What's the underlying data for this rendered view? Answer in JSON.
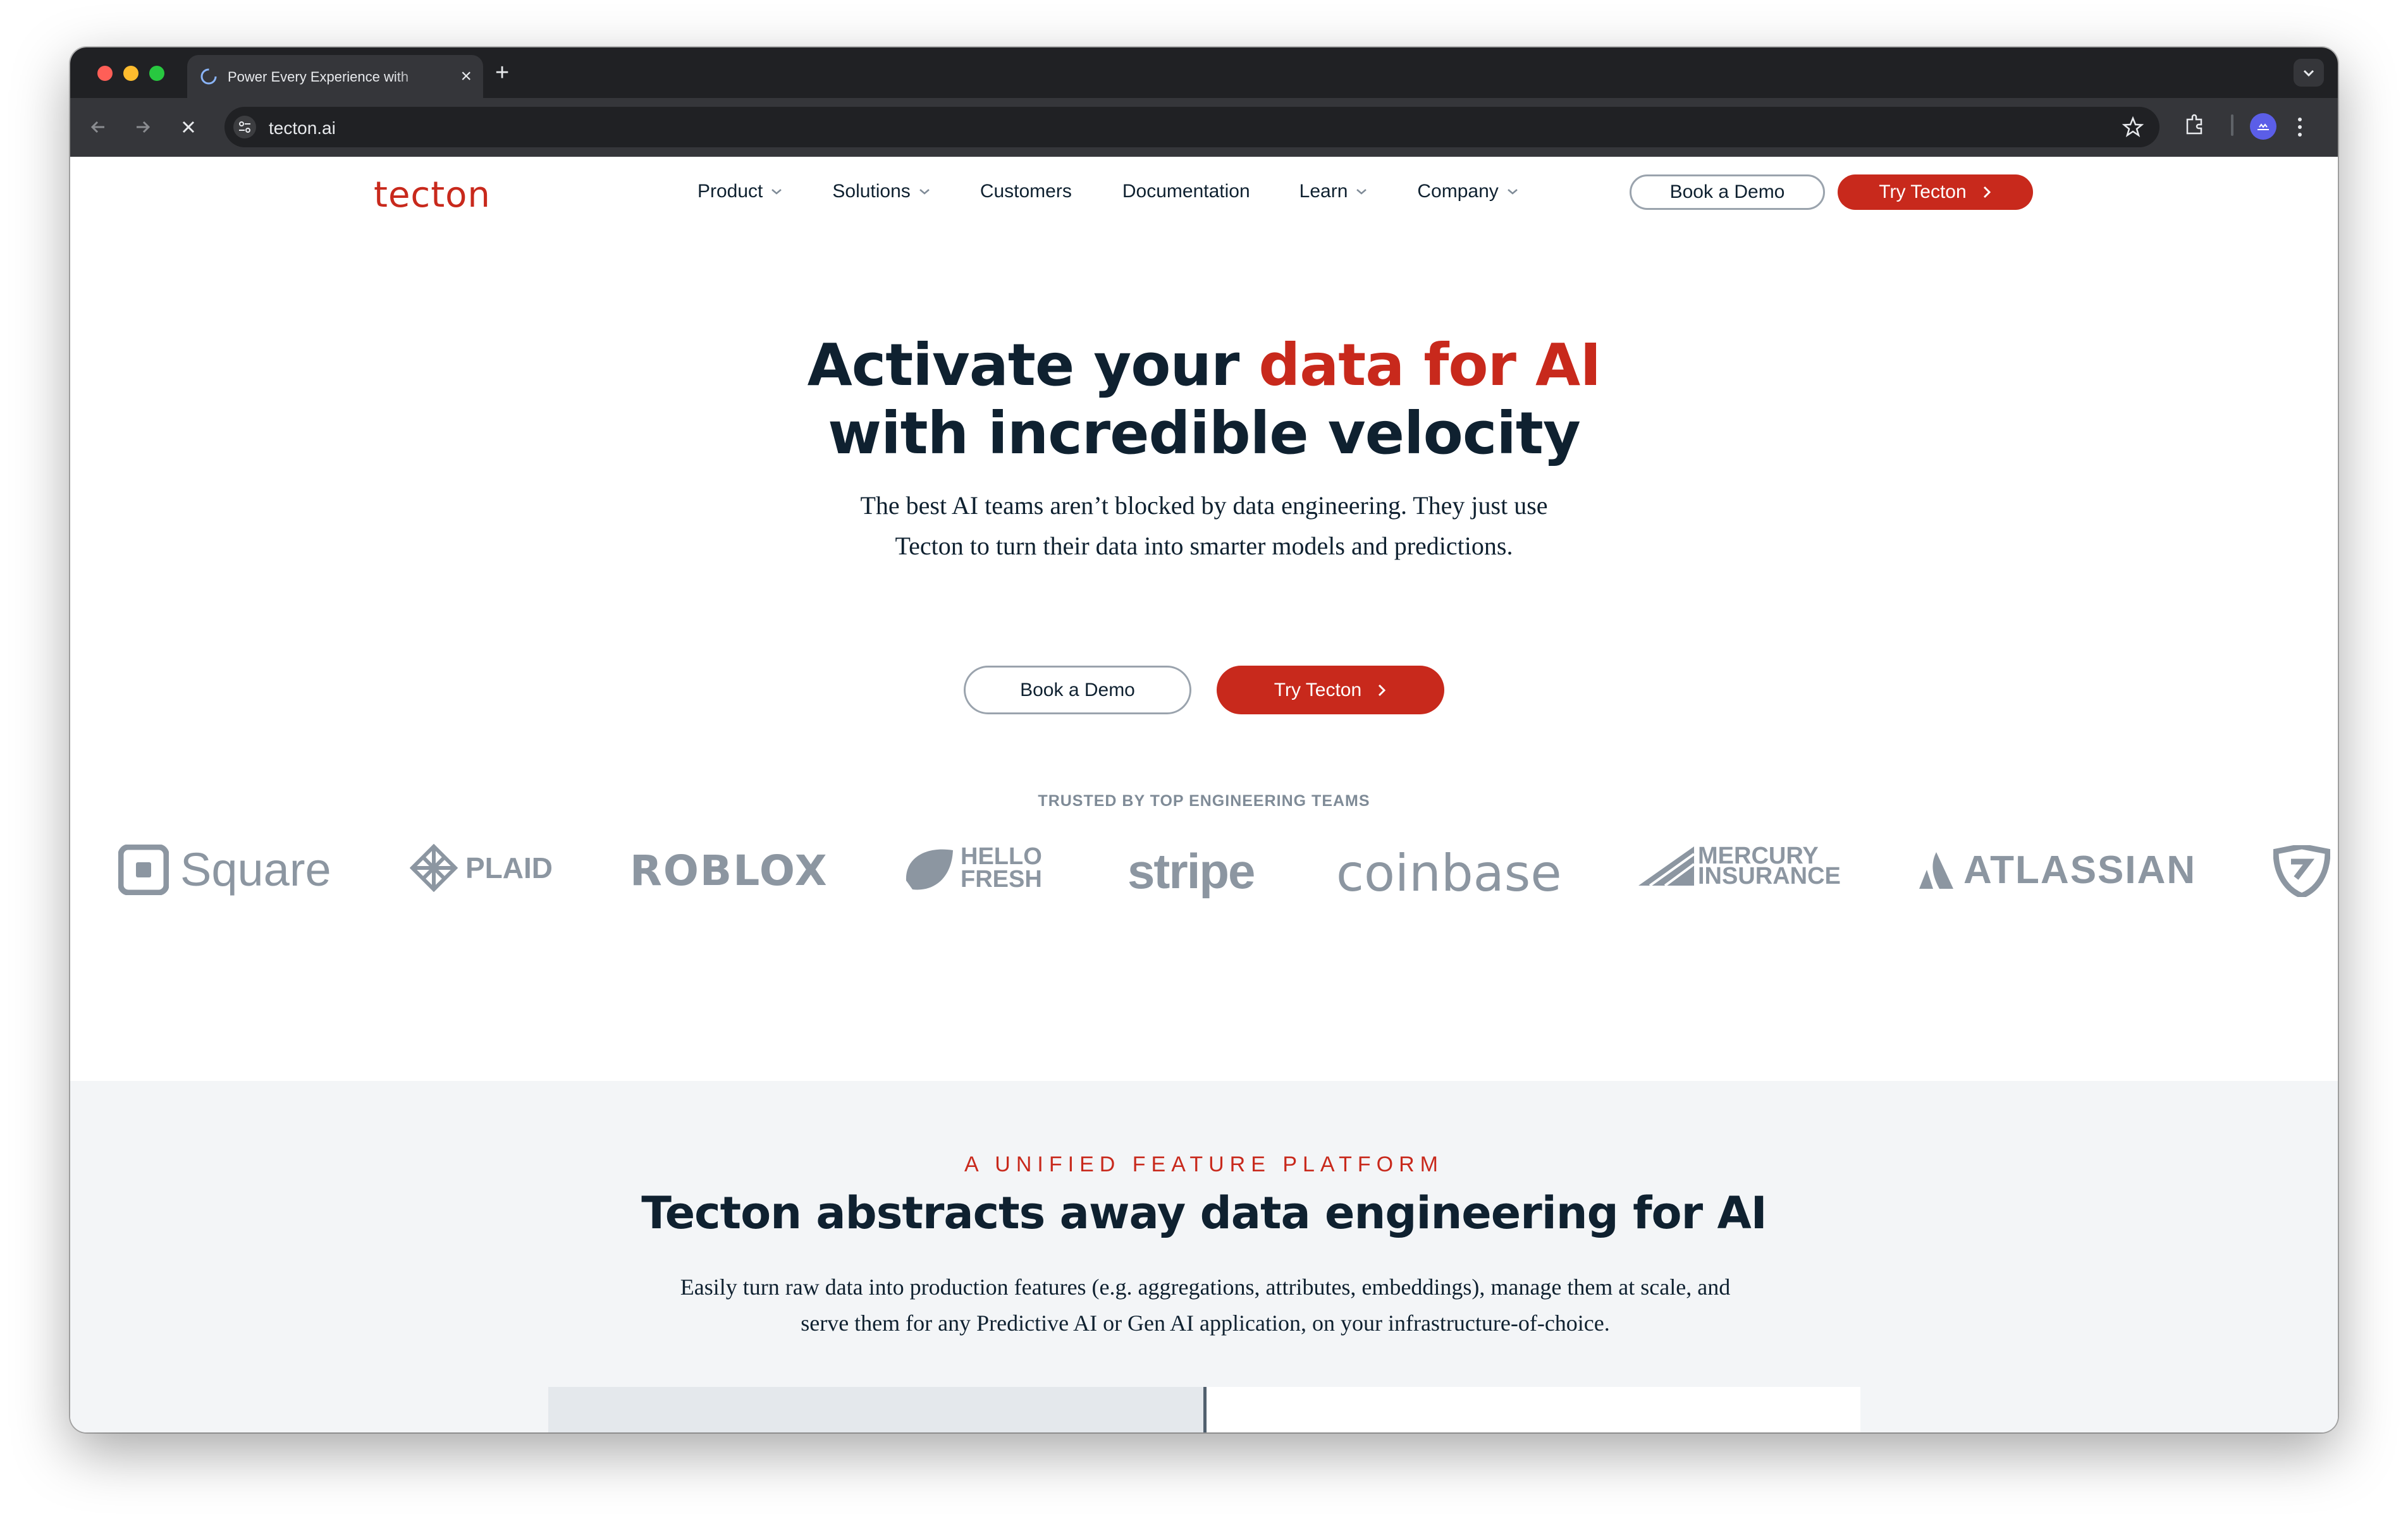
{
  "browser": {
    "tab_title": "Power Every Experience with",
    "tab_close": "×",
    "new_tab": "+",
    "url": "tecton.ai"
  },
  "site": {
    "logo": "tecton",
    "nav": [
      {
        "label": "Product",
        "has_dropdown": true
      },
      {
        "label": "Solutions",
        "has_dropdown": true
      },
      {
        "label": "Customers",
        "has_dropdown": false
      },
      {
        "label": "Documentation",
        "has_dropdown": false
      },
      {
        "label": "Learn",
        "has_dropdown": true
      },
      {
        "label": "Company",
        "has_dropdown": true
      }
    ],
    "header_demo": "Book a Demo",
    "header_try": "Try Tecton"
  },
  "hero": {
    "title_part1": "Activate your ",
    "title_accent": "data for AI",
    "title_line2": "with incredible velocity",
    "subtitle": "The best AI teams aren’t blocked by data engineering. They just use Tecton to turn their data into smarter models and predictions.",
    "demo_button": "Book a Demo",
    "try_button": "Try Tecton"
  },
  "trusted": {
    "heading": "TRUSTED BY TOP ENGINEERING TEAMS",
    "logos": [
      "Square",
      "PLAID",
      "ROBLOX",
      "HELLO FRESH",
      "stripe",
      "coinbase",
      "MERCURY INSURANCE",
      "ATLASSIAN"
    ]
  },
  "platform": {
    "eyebrow": "A UNIFIED FEATURE PLATFORM",
    "title": "Tecton abstracts away data engineering for AI",
    "body": "Easily turn raw data into production features (e.g. aggregations, attributes, embeddings), manage them at scale, and serve them for any Predictive AI or Gen AI application, on your infrastructure-of-choice."
  },
  "colors": {
    "brand_red": "#c8291c",
    "navy": "#0f2130",
    "logo_gray": "#8c96a1",
    "section_bg": "#f3f5f7"
  }
}
